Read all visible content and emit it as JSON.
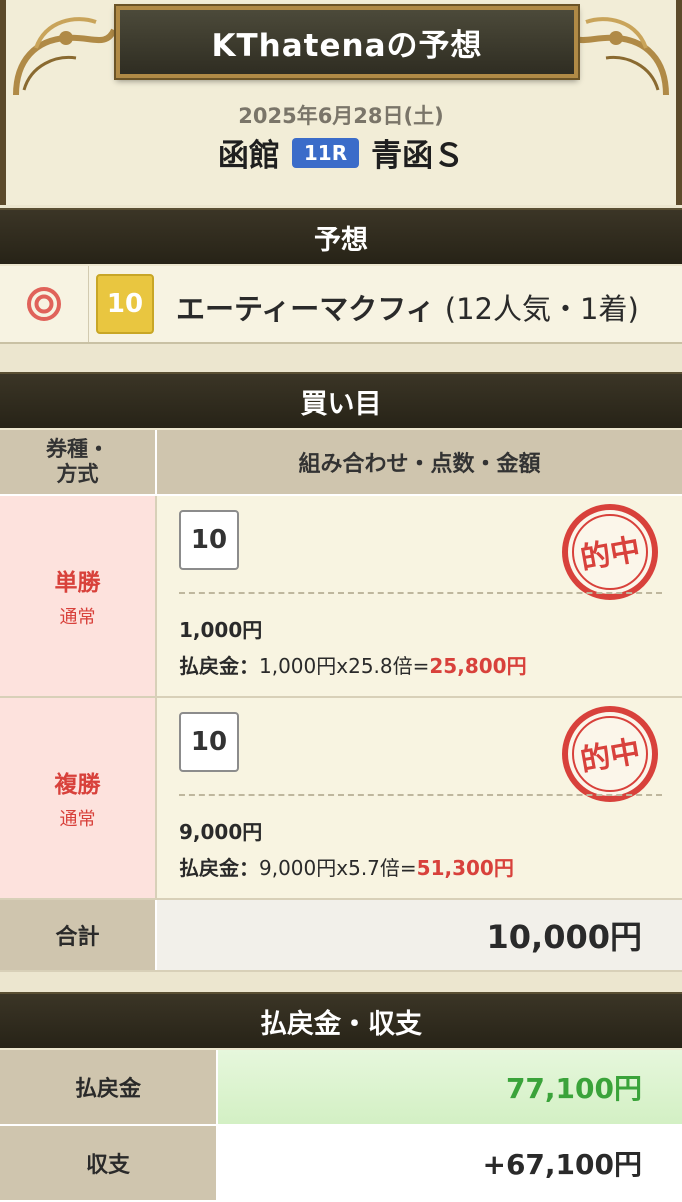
{
  "header": {
    "title": "KThatenaの予想",
    "date": "2025年6月28日(土)",
    "venue": "函館",
    "race_number": "11R",
    "race_name": "青函Ｓ"
  },
  "prediction": {
    "section_title": "予想",
    "mark": "◎",
    "horse_number": "10",
    "horse_name": "エーティーマクフィ",
    "result": "(12人気・1着)",
    "colors": {
      "number_badge": "#e9c640"
    }
  },
  "bets": {
    "section_title": "買い目",
    "header_type": "券種・方式",
    "header_type_line1": "券種・",
    "header_type_line2": "方式",
    "header_combo": "組み合わせ・点数・金額",
    "rows": [
      {
        "type": "単勝",
        "method": "通常",
        "combination": "10",
        "stamp": "的中",
        "amount": "1,000円",
        "payout_label": "払戻金：",
        "payout_calc": "1,000円x25.8倍=",
        "payout_result": "25,800円"
      },
      {
        "type": "複勝",
        "method": "通常",
        "combination": "10",
        "stamp": "的中",
        "amount": "9,000円",
        "payout_label": "払戻金：",
        "payout_calc": "9,000円x5.7倍=",
        "payout_result": "51,300円"
      }
    ],
    "total_label": "合計",
    "total_value": "10,000円"
  },
  "summary": {
    "section_title": "払戻金・収支",
    "payout_label": "払戻金",
    "payout_value": "77,100円",
    "balance_label": "収支",
    "balance_value": "+67,100円",
    "colors": {
      "payout": "#3aa33a",
      "hit": "#d8413b"
    }
  }
}
